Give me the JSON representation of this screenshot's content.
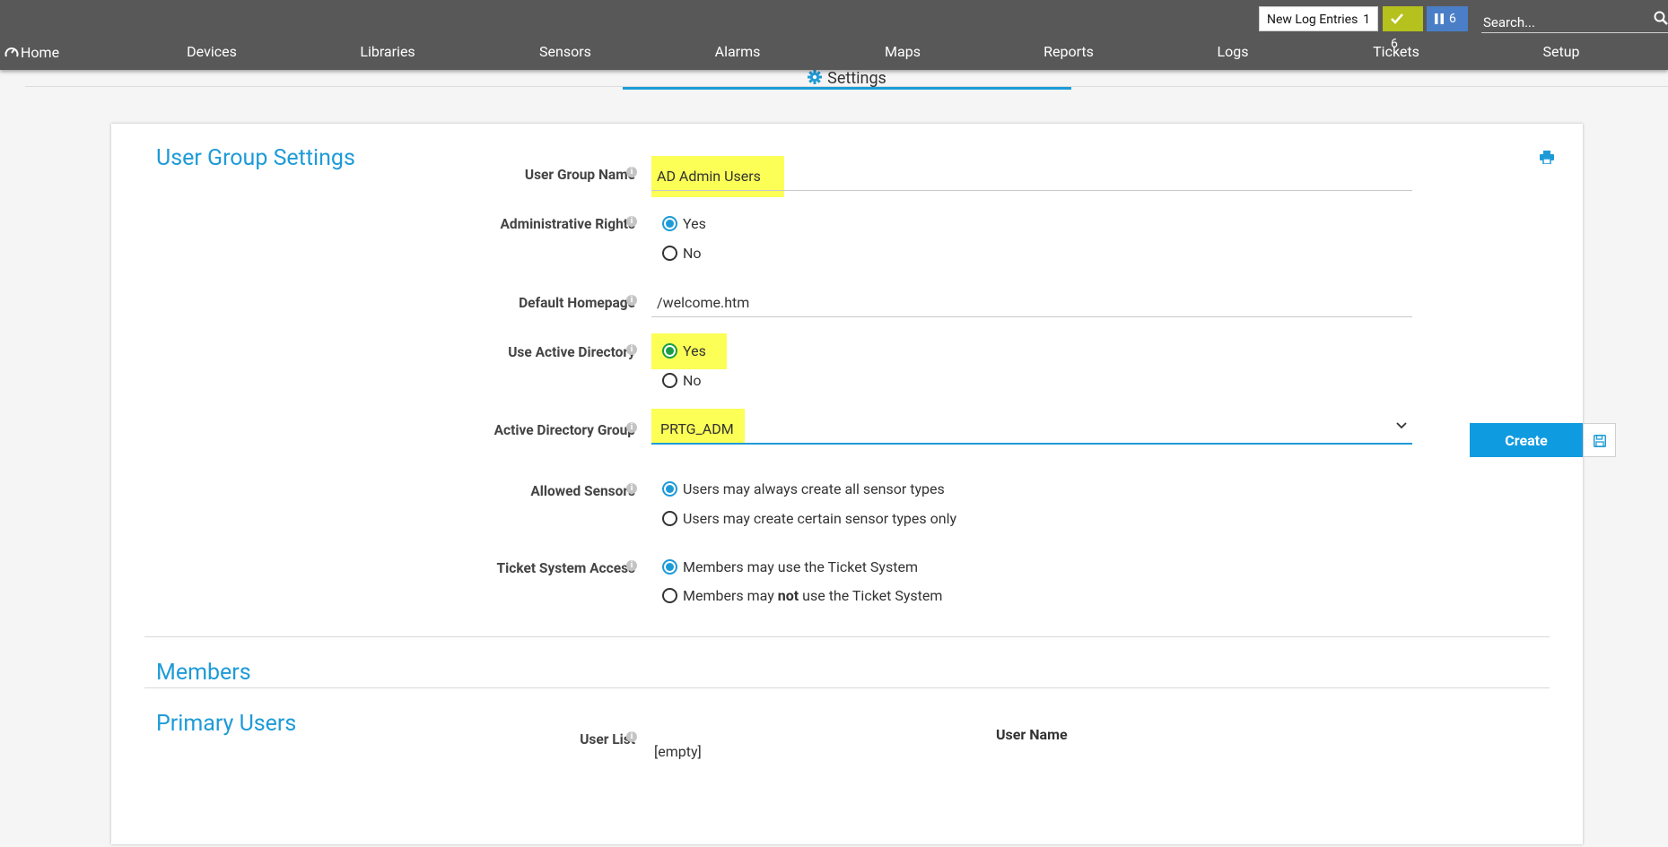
{
  "topbar": {
    "log_button_label": "New Log Entries",
    "log_button_count": "1",
    "ok_count": "6",
    "paused_count": "6",
    "search_placeholder": "Search..."
  },
  "nav": {
    "home": "Home",
    "items": [
      "Devices",
      "Libraries",
      "Sensors",
      "Alarms",
      "Maps",
      "Reports",
      "Logs",
      "Tickets",
      "Setup"
    ]
  },
  "tab": {
    "label": "Settings"
  },
  "form": {
    "section_title": "User Group Settings",
    "group_name": {
      "label": "User Group Name",
      "value": "AD Admin Users"
    },
    "admin_rights": {
      "label": "Administrative Rights",
      "options": [
        "Yes",
        "No"
      ],
      "selected": "Yes"
    },
    "homepage": {
      "label": "Default Homepage",
      "value": "/welcome.htm"
    },
    "active_directory": {
      "label": "Use Active Directory",
      "options": [
        "Yes",
        "No"
      ],
      "selected": "Yes"
    },
    "ad_group": {
      "label": "Active Directory Group",
      "value": "PRTG_ADM"
    },
    "allowed_sensors": {
      "label": "Allowed Sensors",
      "options": [
        "Users may always create all sensor types",
        "Users may create certain sensor types only"
      ],
      "selected": "Users may always create all sensor types"
    },
    "ticket_access": {
      "label": "Ticket System Access",
      "option_1": "Members may use the Ticket System",
      "option_2_prefix": "Members may ",
      "option_2_bold": "not",
      "option_2_suffix": " use the Ticket System",
      "selected": "option_1"
    }
  },
  "members": {
    "title": "Members",
    "primary_users_title": "Primary Users",
    "user_list_label": "User List",
    "column_header": "User Name",
    "empty_text": "[empty]"
  },
  "actions": {
    "create_label": "Create"
  },
  "colors": {
    "accent": "#1e9bd7",
    "topbar": "#585858",
    "highlight": "#fbff56",
    "ok_badge": "#b5c11c",
    "paused_badge": "#4a7fc7",
    "radio_green": "#1a9e45"
  }
}
